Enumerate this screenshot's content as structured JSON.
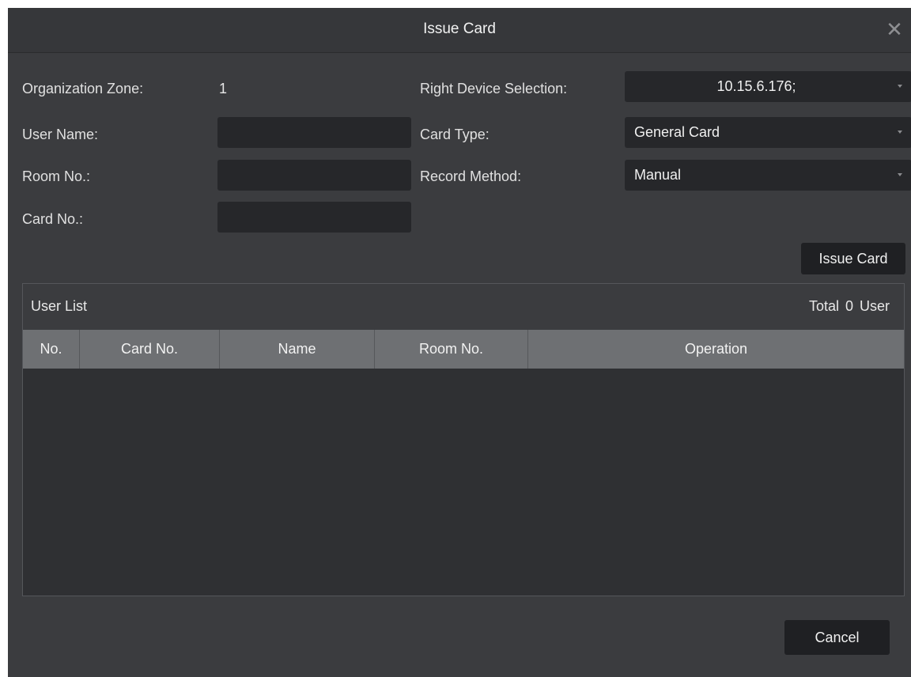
{
  "dialog": {
    "title": "Issue Card",
    "close_glyph": "✕"
  },
  "form": {
    "organization_zone_label": "Organization Zone:",
    "organization_zone_value": "1",
    "user_name_label": "User Name:",
    "user_name_value": "",
    "room_no_label": "Room No.:",
    "room_no_value": "",
    "card_no_label": "Card No.:",
    "card_no_value": "",
    "right_device_label": "Right Device Selection:",
    "right_device_value": "10.15.6.176;",
    "card_type_label": "Card Type:",
    "card_type_value": "General Card",
    "record_method_label": "Record Method:",
    "record_method_value": "Manual",
    "issue_card_button": "Issue Card"
  },
  "user_list": {
    "title": "User List",
    "total_label": "Total",
    "total_count": "0",
    "total_unit": "User",
    "columns": [
      "No.",
      "Card No.",
      "Name",
      "Room No.",
      "Operation"
    ],
    "rows": []
  },
  "footer": {
    "cancel_button": "Cancel"
  },
  "colors": {
    "background": "#3b3c3f",
    "input_bg": "#26272a",
    "table_header": "#6e7073",
    "button_bg": "#1f2023"
  }
}
